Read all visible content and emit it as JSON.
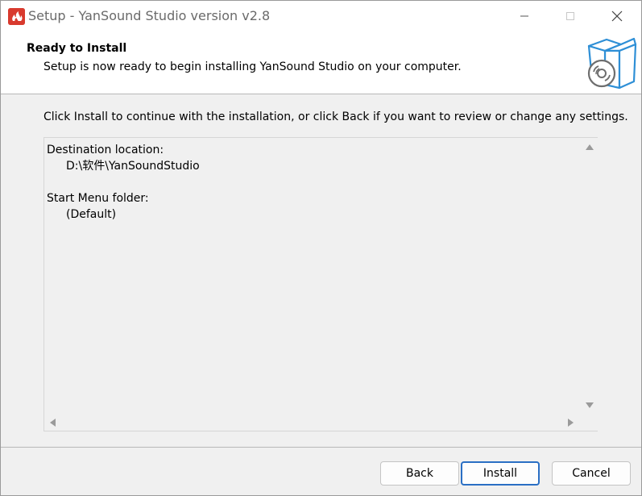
{
  "window": {
    "title": "Setup - YanSound Studio version v2.8",
    "icons": {
      "app": "app-flame-icon",
      "minimize": "minimize-icon",
      "maximize": "maximize-icon",
      "close": "close-icon"
    }
  },
  "header": {
    "title": "Ready to Install",
    "subtitle": "Setup is now ready to begin installing YanSound Studio on your computer.",
    "icon": "install-box-disc-icon"
  },
  "main": {
    "instruction": "Click Install to continue with the installation, or click Back if you want to review or change any settings.",
    "memo": {
      "destination_label": "Destination location:",
      "destination_value": "D:\\软件\\YanSoundStudio",
      "start_menu_label": "Start Menu folder:",
      "start_menu_value": "(Default)"
    }
  },
  "buttons": {
    "back": "Back",
    "install": "Install",
    "cancel": "Cancel"
  },
  "colors": {
    "accent_border": "#2a6fc4",
    "app_icon": "#d83a2e",
    "header_icon": "#2e8fd6"
  }
}
